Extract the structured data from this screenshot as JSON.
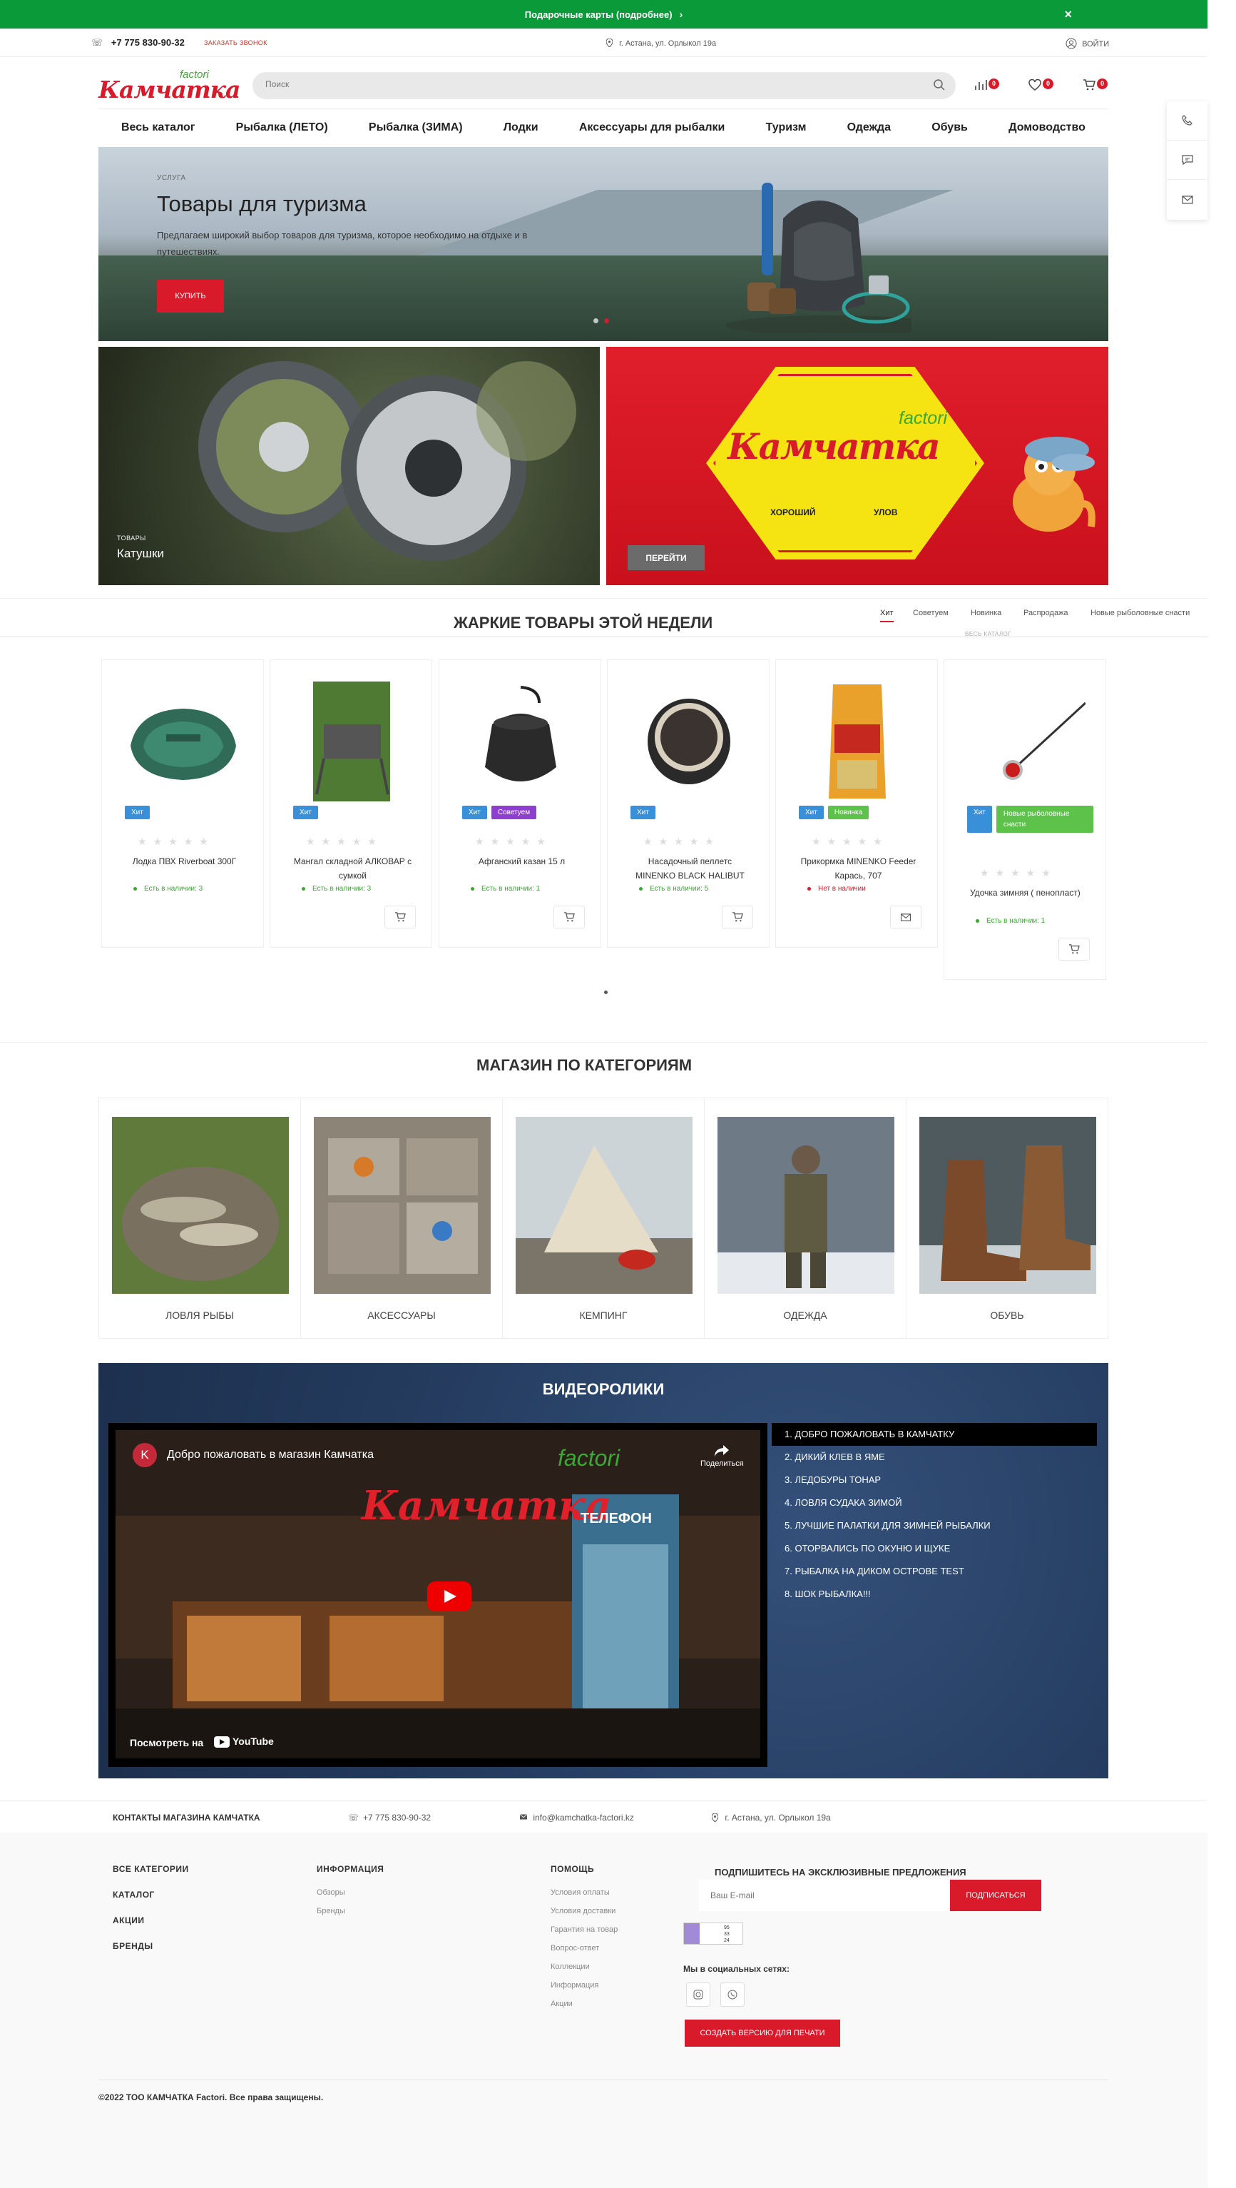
{
  "promo": {
    "text": "Подарочные карты (подробнее)",
    "chevron": "›",
    "close": "×"
  },
  "topline": {
    "phone": "+7 775 830-90-32",
    "callback": "ЗАКАЗАТЬ ЗВОНОК",
    "address": "г. Астана, ул. Орлыкол 19а",
    "login": "ВОЙТИ"
  },
  "header": {
    "logo_text": "Камчатка",
    "logo_sub": "factori",
    "search_placeholder": "Поиск",
    "compare_count": "0",
    "favorites_count": "0",
    "cart_count": "0"
  },
  "nav": [
    "Весь каталог",
    "Рыбалка (ЛЕТО)",
    "Рыбалка (ЗИМА)",
    "Лодки",
    "Аксессуары для рыбалки",
    "Туризм",
    "Одежда",
    "Обувь",
    "Домоводство"
  ],
  "hero": {
    "eyebrow": "УСЛУГА",
    "title": "Товары для туризма",
    "text": "Предлагаем широкий выбор товаров для туризма, которое необходимо на отдыхе и в путешествиях.",
    "button": "КУПИТЬ"
  },
  "banners": {
    "left_small": "ТОВАРЫ",
    "left_title": "Катушки",
    "right_logo": "Камчатка",
    "right_sub": "factori",
    "right_word1": "ХОРОШИЙ",
    "right_word2": "УЛОВ",
    "right_button": "ПЕРЕЙТИ"
  },
  "hot": {
    "title": "ЖАРКИЕ ТОВАРЫ ЭТОЙ НЕДЕЛИ",
    "tabs": [
      "Хит",
      "Советуем",
      "Новинка",
      "Распродажа",
      "Новые рыболовные снасти"
    ],
    "all_catalog": "ВЕСЬ КАТАЛОГ",
    "stars": "★★★★★",
    "products": [
      {
        "name": "Лодка ПВХ Riverboat 300Г",
        "tags": [
          "Хит"
        ],
        "stock": "Есть в наличии: 3",
        "in_stock": true
      },
      {
        "name": "Мангал складной АЛКОВАР с сумкой",
        "tags": [
          "Хит"
        ],
        "stock": "Есть в наличии: 3",
        "in_stock": true
      },
      {
        "name": "Афганский казан 15 л",
        "tags": [
          "Хит",
          "Советуем"
        ],
        "stock": "Есть в наличии: 1",
        "in_stock": true
      },
      {
        "name": "Насадочный пеллетс MINENKO BLACK HALIBUT",
        "tags": [
          "Хит"
        ],
        "stock": "Есть в наличии: 5",
        "in_stock": true
      },
      {
        "name": "Прикормка MINENKO Feeder Карась, 707",
        "tags": [
          "Хит",
          "Новинка"
        ],
        "stock": "Нет в наличии",
        "in_stock": false
      },
      {
        "name": "Удочка зимняя ( пенопласт)",
        "tags": [
          "Хит",
          "Новые рыболовные снасти"
        ],
        "stock": "Есть в наличии: 1",
        "in_stock": true
      }
    ]
  },
  "categories": {
    "title": "МАГАЗИН ПО КАТЕГОРИЯМ",
    "items": [
      "ЛОВЛЯ РЫБЫ",
      "АКСЕССУАРЫ",
      "КЕМПИНГ",
      "ОДЕЖДА",
      "ОБУВЬ"
    ]
  },
  "videos": {
    "title": "ВИДЕОРОЛИКИ",
    "player_avatar": "K",
    "player_title": "Добро пожаловать в магазин Камчатка",
    "share": "Поделиться",
    "watch_on": "Посмотреть на",
    "youtube": "YouTube",
    "sign_text": "Камчатка",
    "sign_sub": "factori",
    "phone_booth": "ТЕЛЕФОН",
    "list": [
      "1. ДОБРО ПОЖАЛОВАТЬ В КАМЧАТКУ",
      "2. ДИКИЙ КЛЕВ В ЯМЕ",
      "3. ЛЕДОБУРЫ ТОНАР",
      "4. ЛОВЛЯ СУДАКА ЗИМОЙ",
      "5. ЛУЧШИЕ ПАЛАТКИ ДЛЯ ЗИМНЕЙ РЫБАЛКИ",
      "6. ОТОРВАЛИСЬ ПО ОКУНЮ И ЩУКЕ",
      "7. РЫБАЛКА НА ДИКОМ ОСТРОВЕ TEST",
      "8. ШОК РЫБАЛКА!!!"
    ]
  },
  "contacts": {
    "title": "КОНТАКТЫ МАГАЗИНА КАМЧАТКА",
    "phone": "+7 775 830-90-32",
    "email": "info@kamchatka-factori.kz",
    "address": "г. Астана, ул. Орлыкол 19а"
  },
  "footer": {
    "col1": [
      "ВСЕ КАТЕГОРИИ",
      "КАТАЛОГ",
      "АКЦИИ",
      "БРЕНДЫ"
    ],
    "col2_title": "ИНФОРМАЦИЯ",
    "col2": [
      "Обзоры",
      "Бренды"
    ],
    "col3_title": "ПОМОЩЬ",
    "col3": [
      "Условия оплаты",
      "Условия доставки",
      "Гарантия на товар",
      "Вопрос-ответ",
      "Коллекции",
      "Информация",
      "Акции"
    ],
    "subscribe_title": "ПОДПИШИТЕСЬ НА ЭКСКЛЮЗИВНЫЕ ПРЕДЛОЖЕНИЯ",
    "email_placeholder": "Ваш E-mail",
    "subscribe_button": "ПОДПИСАТЬСЯ",
    "counter": [
      "95",
      "33",
      "24"
    ],
    "social_title": "Мы в социальных сетях:",
    "print_button": "СОЗДАТЬ ВЕРСИЮ ДЛЯ ПЕЧАТИ",
    "copyright": "©2022 ТОО КАМЧАТКА Factori. Все права защищены."
  }
}
